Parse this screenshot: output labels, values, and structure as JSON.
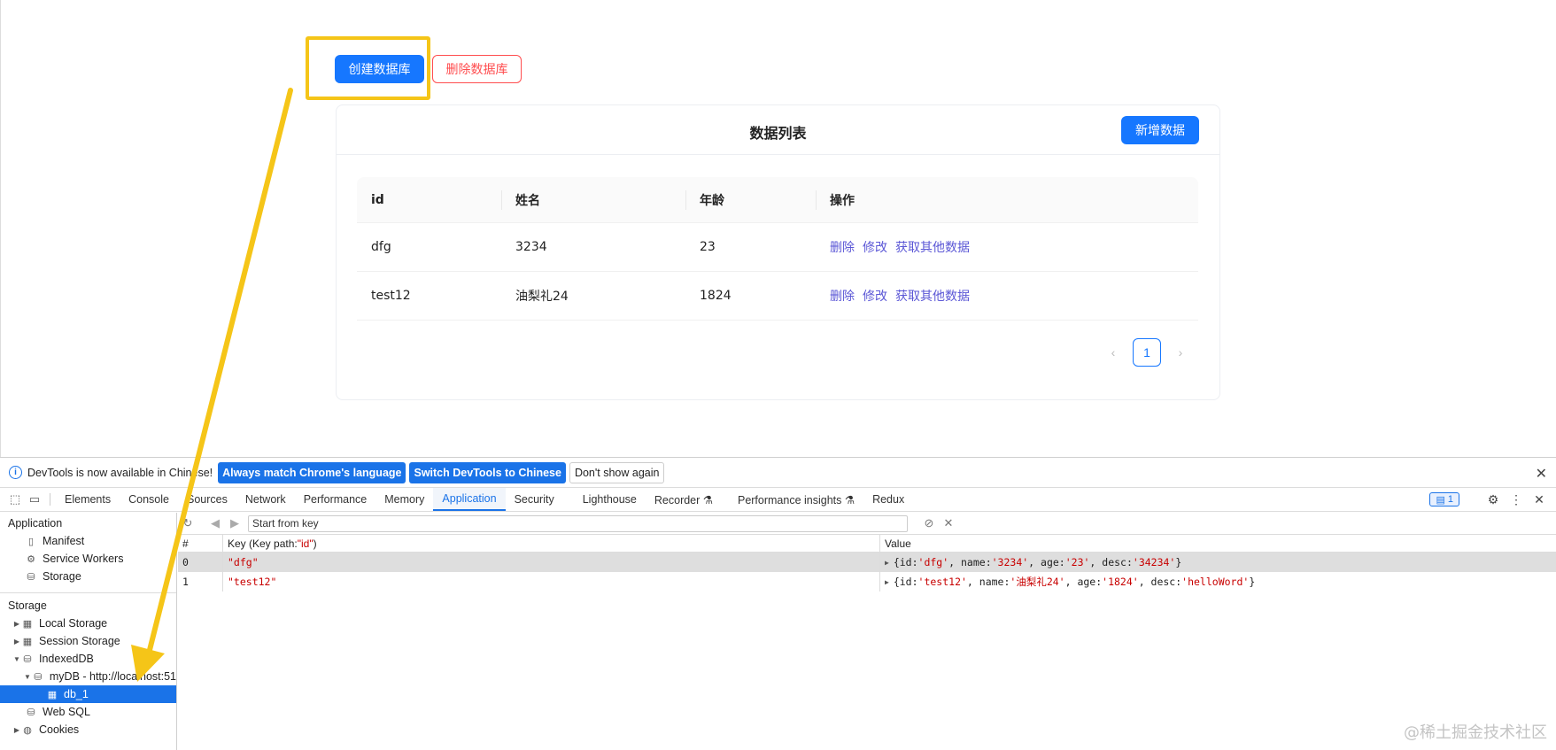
{
  "page": {
    "create_db_label": "创建数据库",
    "delete_db_label": "删除数据库",
    "card_title": "数据列表",
    "add_data_label": "新增数据",
    "table": {
      "headers": [
        "id",
        "姓名",
        "年龄",
        "操作"
      ],
      "rows": [
        {
          "id": "dfg",
          "name": "3234",
          "age": "23"
        },
        {
          "id": "test12",
          "name": "油梨礼24",
          "age": "1824"
        }
      ],
      "actions": [
        "删除",
        "修改",
        "获取其他数据"
      ]
    },
    "pagination": {
      "current": "1",
      "prev_icon": "‹",
      "next_icon": "›"
    }
  },
  "devtools": {
    "infobar": {
      "message": "DevTools is now available in Chinese!",
      "btn_match": "Always match Chrome's language",
      "btn_switch": "Switch DevTools to Chinese",
      "btn_dismiss": "Don't show again"
    },
    "tabs": [
      "Elements",
      "Console",
      "Sources",
      "Network",
      "Performance",
      "Memory",
      "Application",
      "Security",
      "Lighthouse",
      "Recorder ⚗",
      "Performance insights ⚗",
      "Redux"
    ],
    "active_tab": "Application",
    "message_count": "1",
    "sidebar": {
      "app_header": "Application",
      "app_items": [
        "Manifest",
        "Service Workers",
        "Storage"
      ],
      "storage_header": "Storage",
      "storage_items": {
        "local": "Local Storage",
        "session": "Session Storage",
        "indexeddb": "IndexedDB",
        "mydb": "myDB - http://localhost:51",
        "db1": "db_1",
        "websql": "Web SQL",
        "cookies": "Cookies"
      }
    },
    "toolbar": {
      "placeholder": "Start from key"
    },
    "grid": {
      "col_index": "#",
      "col_key_prefix": "Key (Key path: ",
      "col_key_path": "\"id\"",
      "col_key_suffix": ")",
      "col_value": "Value",
      "rows": [
        {
          "index": "0",
          "key": "\"dfg\"",
          "id": "'dfg'",
          "name": "'3234'",
          "age": "'23'",
          "desc": "'34234'"
        },
        {
          "index": "1",
          "key": "\"test12\"",
          "id": "'test12'",
          "name": "'油梨礼24'",
          "age": "'1824'",
          "desc": "'helloWord'"
        }
      ]
    }
  },
  "watermark": "@稀土掘金技术社区",
  "colors": {
    "primary": "#1677ff",
    "danger": "#ff4d4f",
    "link": "#5b57d6",
    "highlight": "#f5c518",
    "devtools_blue": "#1a73e8"
  }
}
